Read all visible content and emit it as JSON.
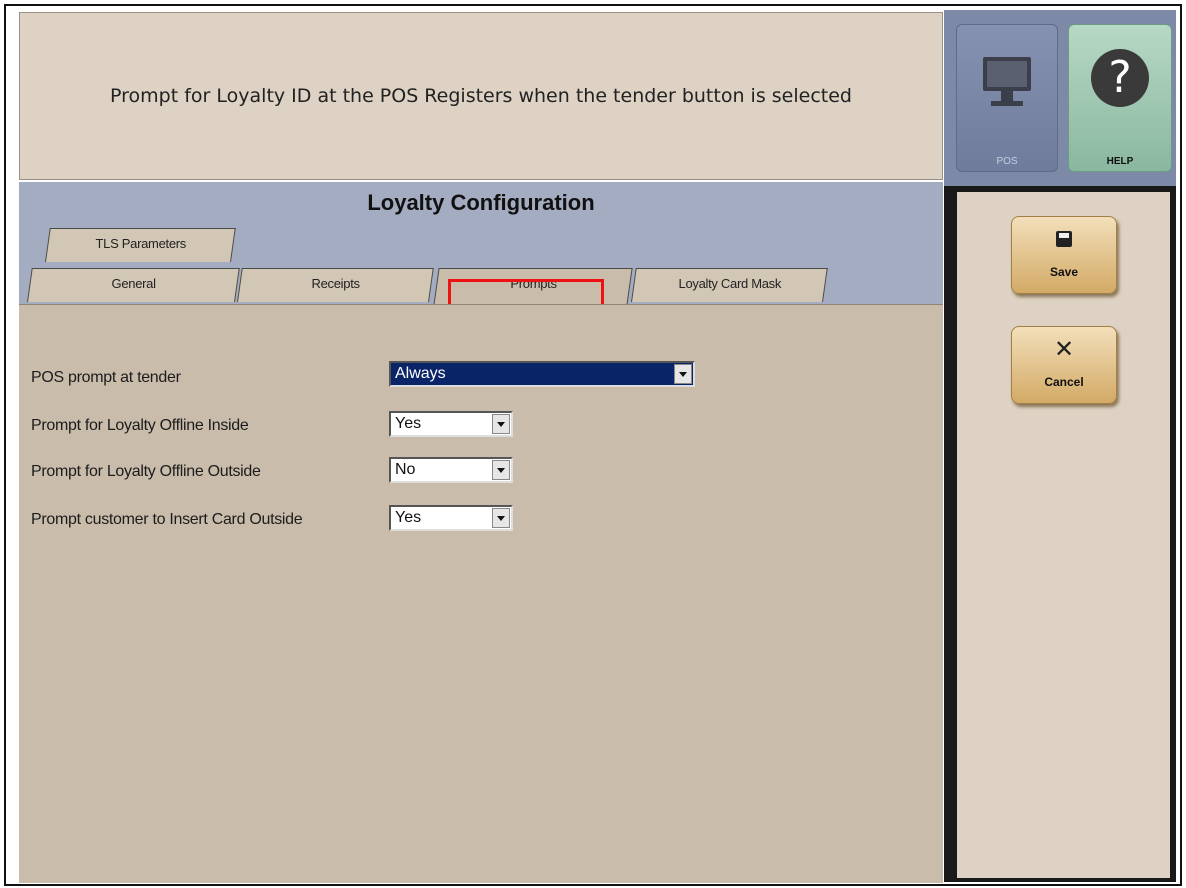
{
  "banner": {
    "text": "Prompt for Loyalty ID at the POS Registers when the tender button is selected"
  },
  "top_buttons": {
    "pos_label": "POS",
    "help_label": "HELP",
    "help_glyph": "?"
  },
  "page": {
    "title": "Loyalty Configuration"
  },
  "tabs": {
    "row_back": [
      {
        "label": "TLS Parameters"
      }
    ],
    "row_front": [
      {
        "label": "General"
      },
      {
        "label": "Receipts"
      },
      {
        "label": "Prompts",
        "active": true
      },
      {
        "label": "Loyalty Card Mask"
      }
    ]
  },
  "fields": [
    {
      "label": "POS prompt at tender",
      "value": "Always"
    },
    {
      "label": "Prompt for Loyalty Offline Inside",
      "value": "Yes"
    },
    {
      "label": "Prompt for Loyalty Offline Outside",
      "value": "No"
    },
    {
      "label": "Prompt customer to Insert Card Outside",
      "value": "Yes"
    }
  ],
  "actions": {
    "save_label": "Save",
    "cancel_label": "Cancel"
  },
  "colors": {
    "highlight": "#ee1111",
    "selected_field": "#0a2468",
    "accent_button": "#d3aa66"
  }
}
